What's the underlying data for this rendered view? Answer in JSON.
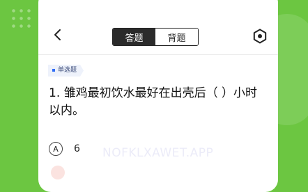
{
  "header": {
    "back_icon": "chevron-left-icon",
    "mode_tabs": [
      {
        "label": "答题",
        "active": true
      },
      {
        "label": "背题",
        "active": false
      }
    ],
    "settings_icon": "hexagon-settings-icon"
  },
  "question": {
    "type_tag": "单选题",
    "text": "1. 雏鸡最初饮水最好在出壳后（ ）小时以内。"
  },
  "options": [
    {
      "letter": "A",
      "text": "6"
    }
  ],
  "watermark": "NOFKLXAWET.APP",
  "colors": {
    "background": "#6cc641",
    "card": "#ffffff",
    "active_tab": "#2b2b2b",
    "tag_bg": "#eef2fb",
    "tag_dot": "#2f6cf6"
  }
}
